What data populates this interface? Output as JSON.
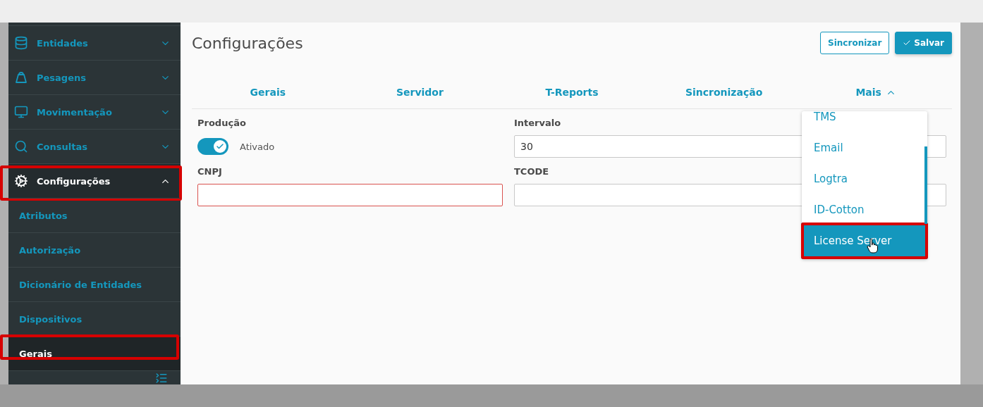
{
  "sidebar": {
    "items": [
      {
        "label": "Entidades",
        "expanded": false,
        "selected": false,
        "highlighted": false
      },
      {
        "label": "Pesagens",
        "expanded": false,
        "selected": false,
        "highlighted": false
      },
      {
        "label": "Movimentação",
        "expanded": false,
        "selected": false,
        "highlighted": false
      },
      {
        "label": "Consultas",
        "expanded": false,
        "selected": false,
        "highlighted": false
      },
      {
        "label": "Configurações",
        "expanded": true,
        "selected": true,
        "highlighted": true,
        "children": [
          {
            "label": "Atributos",
            "selected": false,
            "highlighted": false
          },
          {
            "label": "Autorização",
            "selected": false,
            "highlighted": false
          },
          {
            "label": "Dicionário de Entidades",
            "selected": false,
            "highlighted": false
          },
          {
            "label": "Dispositivos",
            "selected": false,
            "highlighted": false
          },
          {
            "label": "Gerais",
            "selected": true,
            "highlighted": true
          }
        ]
      }
    ]
  },
  "page": {
    "title": "Configurações",
    "actions": [
      {
        "label": "Sincronizar",
        "kind": "outline"
      },
      {
        "label": "Salvar",
        "kind": "primary"
      }
    ]
  },
  "tabs": [
    {
      "label": "Gerais",
      "selected": false
    },
    {
      "label": "Servidor",
      "selected": false
    },
    {
      "label": "T-Reports",
      "selected": false
    },
    {
      "label": "Sincronização",
      "selected": false
    },
    {
      "label": "Mais",
      "selected": false,
      "kind": "menu",
      "expanded": true
    }
  ],
  "menu": {
    "items": [
      {
        "label": "TMS",
        "selected": false,
        "highlighted": false
      },
      {
        "label": "Email",
        "selected": false,
        "highlighted": false
      },
      {
        "label": "Logtra",
        "selected": false,
        "highlighted": false
      },
      {
        "label": "ID-Cotton",
        "selected": false,
        "highlighted": false
      },
      {
        "label": "License Server",
        "selected": true,
        "highlighted": true
      }
    ]
  },
  "form": {
    "fields": [
      {
        "label": "Produção",
        "kind": "toggle",
        "on": true,
        "text": "Ativado"
      },
      {
        "label": "Intervalo",
        "kind": "input",
        "value": "30",
        "invalid": false
      },
      {
        "label": "CNPJ",
        "kind": "input",
        "invalid": true
      },
      {
        "label": "TCODE",
        "kind": "input",
        "invalid": false
      }
    ]
  }
}
